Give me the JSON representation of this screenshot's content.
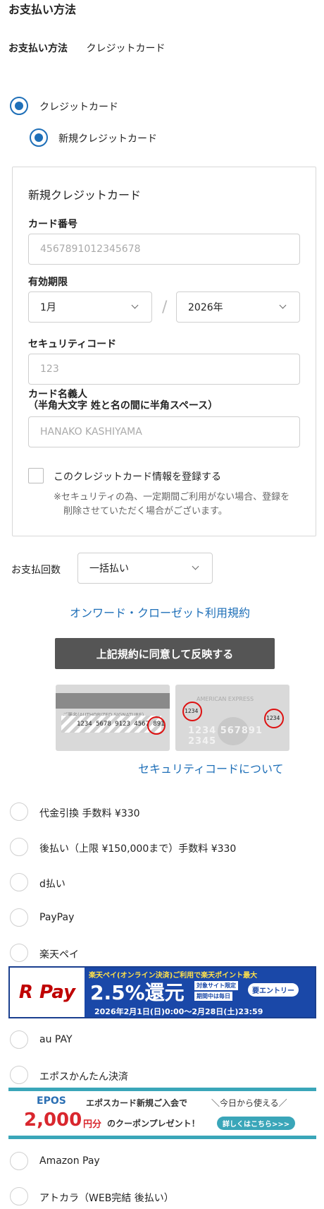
{
  "header": {
    "title": "お支払い方法"
  },
  "summary": {
    "label": "お支払い方法",
    "value": "クレジットカード"
  },
  "methods": {
    "credit": "クレジットカード",
    "new_credit": "新規クレジットカード"
  },
  "card_form": {
    "title": "新規クレジットカード",
    "number_label": "カード番号",
    "number_placeholder": "4567891012345678",
    "expiry_label": "有効期限",
    "month": "1月",
    "slash": "/",
    "year": "2026年",
    "cvc_label": "セキュリティコード",
    "cvc_placeholder": "123",
    "name_label_line1": "カード名義人",
    "name_label_line2": "（半角大文字 姓と名の間に半角スペース）",
    "name_placeholder": "HANAKO KASHIYAMA",
    "register_label": "このクレジットカード情報を登録する",
    "note_line1": "※セキュリティの為、一定期間ご利用がない場合、登録を",
    "note_line2": "削除させていただく場合がございます。"
  },
  "installments": {
    "label": "お支払回数",
    "value": "一括払い"
  },
  "terms_link": "オンワード・クローゼット利用規約",
  "agree_button": "上記規約に同意して反映する",
  "cvc_help": {
    "card1_sig": "ご署名(AUTHORIZED SIGNATURE)",
    "card1_num": "1234 5678 9123 4567 891",
    "card2_brand": "AMERICAN EXPRESS",
    "card2_code": "1234",
    "card2_num": "1234 567891 2345",
    "link": "セキュリティコードについて"
  },
  "options": [
    {
      "label": "代金引換 手数料 ¥330"
    },
    {
      "label": "後払い（上限 ¥150,000まで）手数料 ¥330"
    },
    {
      "label": "d払い"
    },
    {
      "label": "PayPay"
    },
    {
      "label": "楽天ペイ"
    },
    {
      "label": "au PAY"
    },
    {
      "label": "エポスかんたん決済"
    },
    {
      "label": "Amazon Pay"
    },
    {
      "label": "アトカラ（WEB完結 後払い）"
    }
  ],
  "rpay_banner": {
    "logo": "R Pay",
    "line1": "楽天ペイ(オンライン決済)ご利用で楽天ポイント最大",
    "big": "2.5%還元",
    "tag1": "対象サイト限定",
    "tag2": "期間中は毎日",
    "entry": "要エントリー",
    "period": "2026年2月1日(日)0:00～2月28日(土)23:59"
  },
  "epos_banner": {
    "logo": "EPOS",
    "line1": "エポスカード新規ご入会で",
    "line1b": "＼今日から使える／",
    "amount": "2,000",
    "unit": "円分",
    "line2": "のクーポンプレゼント！",
    "button": "詳しくはこちら>>>"
  },
  "colors": {
    "accent": "#1e6fb8",
    "button": "#555555",
    "rakuten": "#bf0000",
    "epos": "#3aa6b9"
  }
}
